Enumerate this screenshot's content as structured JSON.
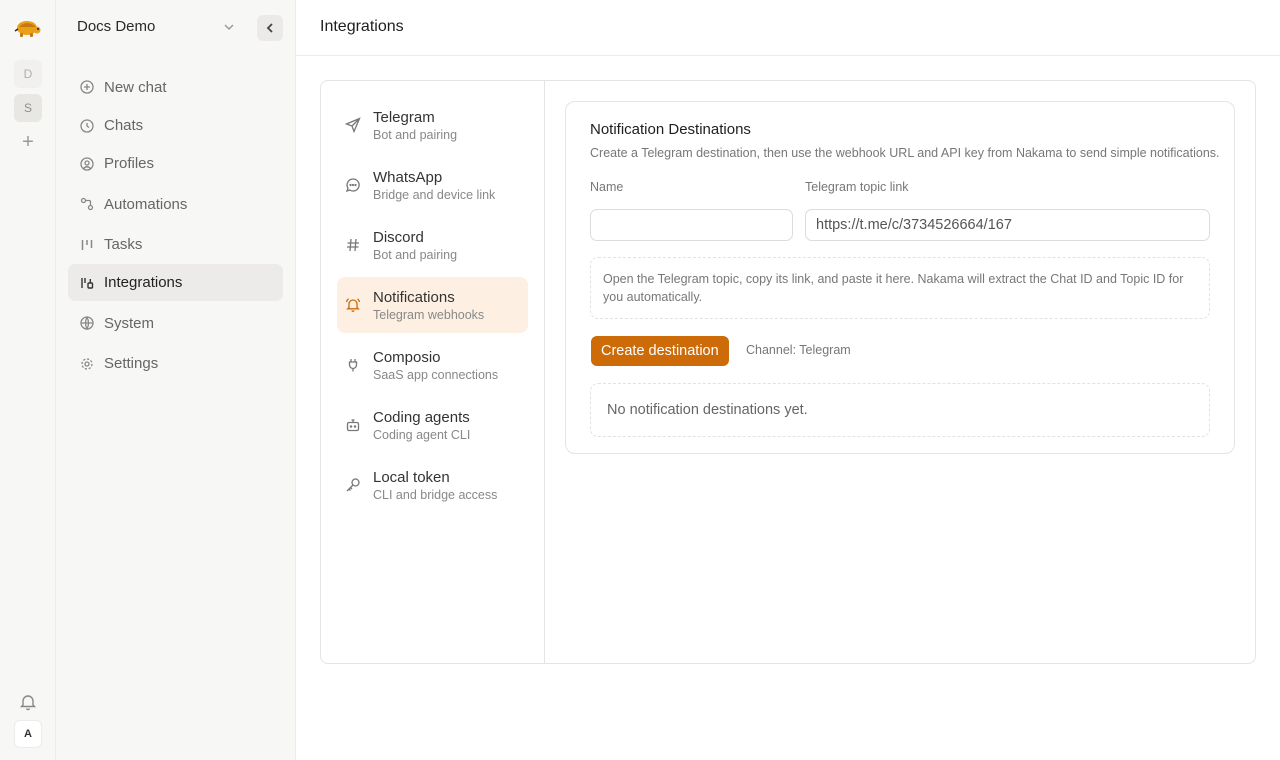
{
  "rail": {
    "workspaces": [
      "D",
      "S"
    ],
    "user_initial": "A",
    "logo": "turtle-logo",
    "icons": {
      "add": "plus-icon",
      "notifications": "bell-icon"
    }
  },
  "sidebar": {
    "workspace_name": "Docs Demo",
    "items": [
      {
        "label": "New chat",
        "icon": "plus-circle-icon"
      },
      {
        "label": "Chats",
        "icon": "clock-icon"
      },
      {
        "label": "Profiles",
        "icon": "user-circle-icon"
      },
      {
        "label": "Automations",
        "icon": "workflow-icon"
      },
      {
        "label": "Tasks",
        "icon": "kanban-icon"
      },
      {
        "label": "Integrations",
        "icon": "integrations-icon",
        "active": true
      },
      {
        "label": "System",
        "icon": "globe-icon"
      },
      {
        "label": "Settings",
        "icon": "gear-icon"
      }
    ]
  },
  "header": {
    "title": "Integrations"
  },
  "integrations": [
    {
      "name": "Telegram",
      "sub": "Bot and pairing",
      "icon": "send-icon"
    },
    {
      "name": "WhatsApp",
      "sub": "Bridge and device link",
      "icon": "message-circle-icon"
    },
    {
      "name": "Discord",
      "sub": "Bot and pairing",
      "icon": "hash-icon"
    },
    {
      "name": "Notifications",
      "sub": "Telegram webhooks",
      "icon": "bell-icon",
      "active": true
    },
    {
      "name": "Composio",
      "sub": "SaaS app connections",
      "icon": "plug-icon"
    },
    {
      "name": "Coding agents",
      "sub": "Coding agent CLI",
      "icon": "bot-icon"
    },
    {
      "name": "Local token",
      "sub": "CLI and bridge access",
      "icon": "key-icon"
    }
  ],
  "destinations": {
    "title": "Notification Destinations",
    "description": "Create a Telegram destination, then use the webhook URL and API key from Nakama to send simple notifications.",
    "name_label": "Name",
    "name_value": "",
    "link_label": "Telegram topic link",
    "link_value": "https://t.me/c/3734526664/167",
    "hint": "Open the Telegram topic, copy its link, and paste it here. Nakama will extract the Chat ID and Topic ID for you automatically.",
    "create_label": "Create destination",
    "channel_text": "Channel: Telegram",
    "empty_text": "No notification destinations yet."
  },
  "colors": {
    "accent": "#cc6b08",
    "active_bg": "#fdf0e2"
  }
}
